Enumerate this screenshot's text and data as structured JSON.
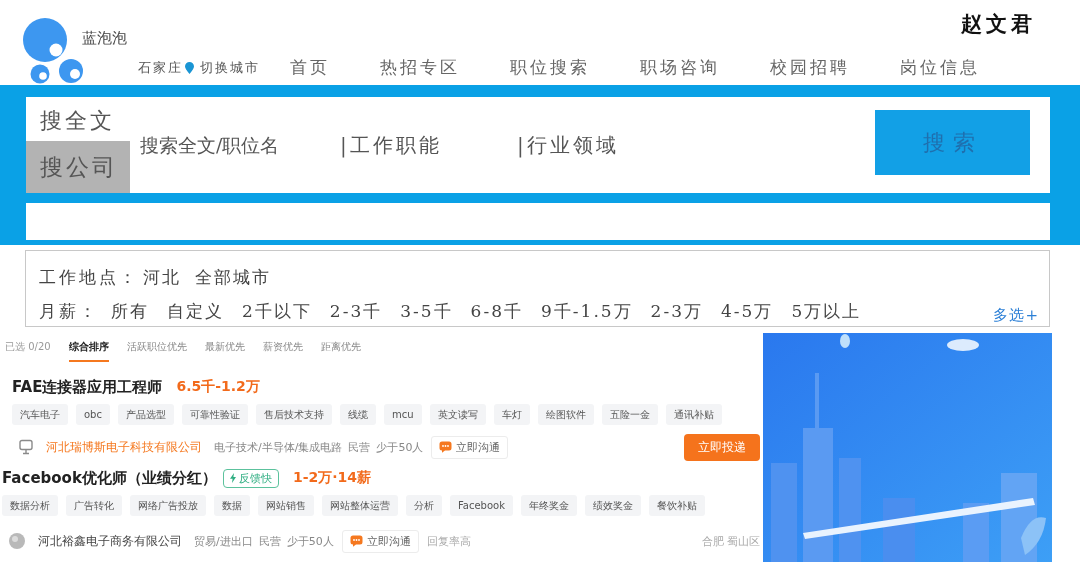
{
  "header": {
    "brand": "蓝泡泡",
    "user_name": "赵文君",
    "city": "石家庄",
    "switch_city": "切换城市",
    "nav": [
      "首页",
      "热招专区",
      "职位搜索",
      "职场咨询",
      "校园招聘",
      "岗位信息"
    ]
  },
  "search": {
    "modes": [
      {
        "label": "搜全文",
        "selected": false
      },
      {
        "label": "搜公司",
        "selected": true
      }
    ],
    "keyword": {
      "placeholder": "搜索全文/职位名"
    },
    "selectors": [
      "|工作职能",
      "|行业领域"
    ],
    "button": "搜索"
  },
  "filters": {
    "location": {
      "label": "工作地点：",
      "values": [
        "河北",
        "全部城市"
      ]
    },
    "salary": {
      "label": "月薪：",
      "options": [
        "所有",
        "自定义",
        "2千以下",
        "2-3千",
        "3-5千",
        "6-8千",
        "9千-1.5万",
        "2-3万",
        "4-5万",
        "5万以上"
      ]
    },
    "multi_select": "多选+"
  },
  "job_list": {
    "selected_count": "已选 0/20",
    "tabs": [
      {
        "label": "综合排序",
        "selected": true
      },
      {
        "label": "活跃职位优先",
        "selected": false
      },
      {
        "label": "最新优先",
        "selected": false
      },
      {
        "label": "薪资优先",
        "selected": false
      },
      {
        "label": "距离优先",
        "selected": false
      }
    ],
    "jobs": [
      {
        "title": "FAE连接器应用工程师",
        "salary": "6.5千-1.2万",
        "tags": [
          "汽车电子",
          "obc",
          "产品选型",
          "可靠性验证",
          "售后技术支持",
          "线缆",
          "mcu",
          "英文读写",
          "车灯",
          "绘图软件",
          "五险一金",
          "通讯补贴"
        ],
        "company": {
          "name": "河北瑞博斯电子科技有限公司",
          "highlighted": true,
          "details": [
            "电子技术/半导体/集成电路",
            "民营",
            "少于50人"
          ]
        },
        "chat": "立即沟通",
        "apply": "立即投递"
      },
      {
        "title": "Facebook优化师（业绩分红）",
        "badge": "反馈快",
        "salary": "1-2万·14薪",
        "tags": [
          "数据分析",
          "广告转化",
          "网络广告投放",
          "数据",
          "网站销售",
          "网站整体运营",
          "分析",
          "Facebook",
          "年终奖金",
          "绩效奖金",
          "餐饮补贴"
        ],
        "company": {
          "name": "河北裕鑫电子商务有限公司",
          "highlighted": false,
          "details": [
            "贸易/进出口",
            "民营",
            "少于50人"
          ]
        },
        "chat": "立即沟通",
        "reply_rate": "回复率高",
        "location": "合肥 蜀山区"
      }
    ]
  }
}
